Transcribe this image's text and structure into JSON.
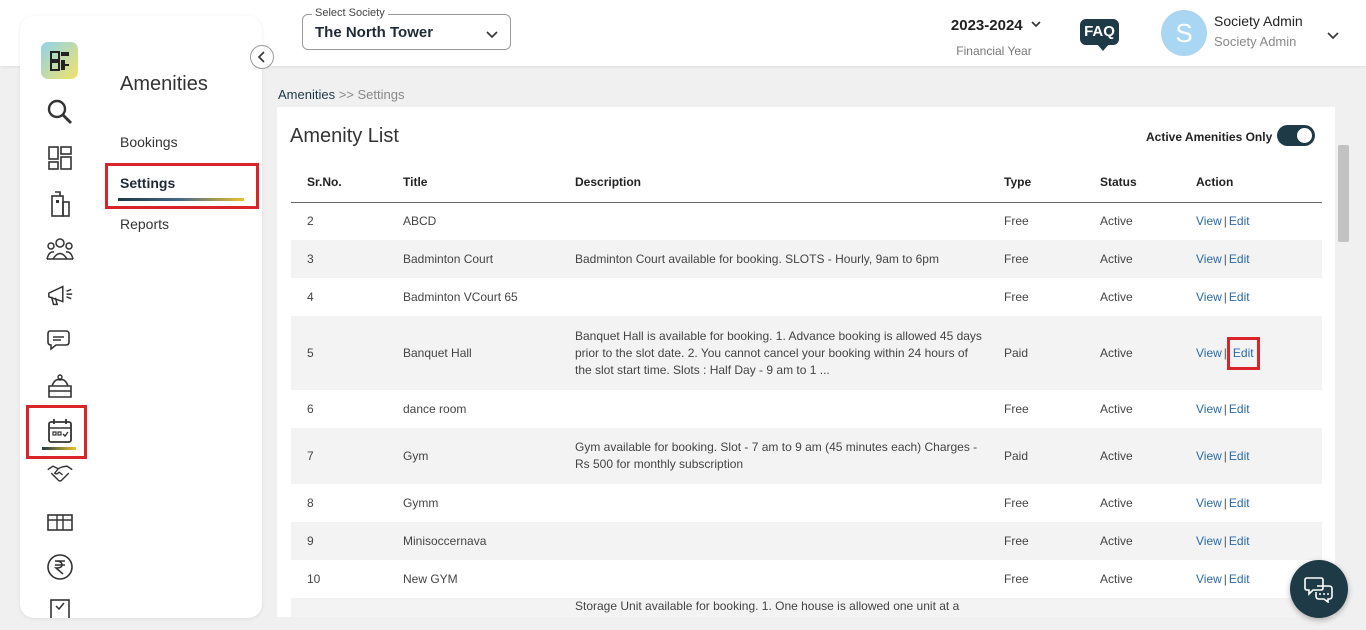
{
  "header": {
    "society_label": "Select Society",
    "society_value": "The North Tower",
    "financial_year": "2023-2024",
    "financial_year_label": "Financial Year",
    "faq_label": "FAQ",
    "avatar_letter": "S",
    "user_name": "Society Admin",
    "user_role": "Society Admin"
  },
  "rail": {
    "icons": [
      "logo-icon",
      "search-icon",
      "dashboard-icon",
      "building-icon",
      "members-icon",
      "announcement-icon",
      "chat-icon",
      "services-icon",
      "amenities-calendar-icon",
      "handshake-icon",
      "package-icon",
      "rupee-icon",
      "checklist-icon"
    ],
    "active": "amenities-calendar-icon"
  },
  "submenu": {
    "title": "Amenities",
    "items": [
      {
        "label": "Bookings"
      },
      {
        "label": "Settings"
      },
      {
        "label": "Reports"
      }
    ],
    "active": "Settings"
  },
  "breadcrumb": {
    "root": "Amenities",
    "separator": ">>",
    "current": "Settings"
  },
  "main": {
    "title": "Amenity List",
    "toggle_label": "Active Amenities Only",
    "toggle_on": true
  },
  "table": {
    "columns": [
      "Sr.No.",
      "Title",
      "Description",
      "Type",
      "Status",
      "Action"
    ],
    "view_label": "View",
    "edit_label": "Edit",
    "rows": [
      {
        "sr": "2",
        "title": "ABCD",
        "description": "",
        "type": "Free",
        "status": "Active"
      },
      {
        "sr": "3",
        "title": "Badminton Court",
        "description": "Badminton Court available for booking. SLOTS - Hourly, 9am to 6pm",
        "type": "Free",
        "status": "Active"
      },
      {
        "sr": "4",
        "title": "Badminton VCourt 65",
        "description": "",
        "type": "Free",
        "status": "Active"
      },
      {
        "sr": "5",
        "title": "Banquet Hall",
        "description": "Banquet Hall is available for booking.  1. Advance booking is allowed 45 days prior to the slot date. 2. You cannot cancel your booking within 24 hours of the slot start time. Slots :  Half Day - 9 am to 1 ...",
        "type": "Paid",
        "status": "Active"
      },
      {
        "sr": "6",
        "title": "dance room",
        "description": "",
        "type": "Free",
        "status": "Active"
      },
      {
        "sr": "7",
        "title": "Gym",
        "description": "Gym available for booking. Slot - 7 am to 9 am (45 minutes each) Charges - Rs 500 for monthly subscription",
        "type": "Paid",
        "status": "Active"
      },
      {
        "sr": "8",
        "title": "Gymm",
        "description": "",
        "type": "Free",
        "status": "Active"
      },
      {
        "sr": "9",
        "title": "Minisoccernava",
        "description": "",
        "type": "Free",
        "status": "Active"
      },
      {
        "sr": "10",
        "title": "New GYM",
        "description": "",
        "type": "Free",
        "status": "Active"
      },
      {
        "sr": "",
        "title": "",
        "description": "Storage Unit available for booking. 1. One house is allowed one unit at a",
        "type": "",
        "status": ""
      }
    ],
    "highlighted_edit_row": 3
  },
  "colors": {
    "primary": "#1e3a46",
    "link": "#2a6aa8",
    "highlight": "#d9252a",
    "accent_gold": "#e8c22a"
  }
}
